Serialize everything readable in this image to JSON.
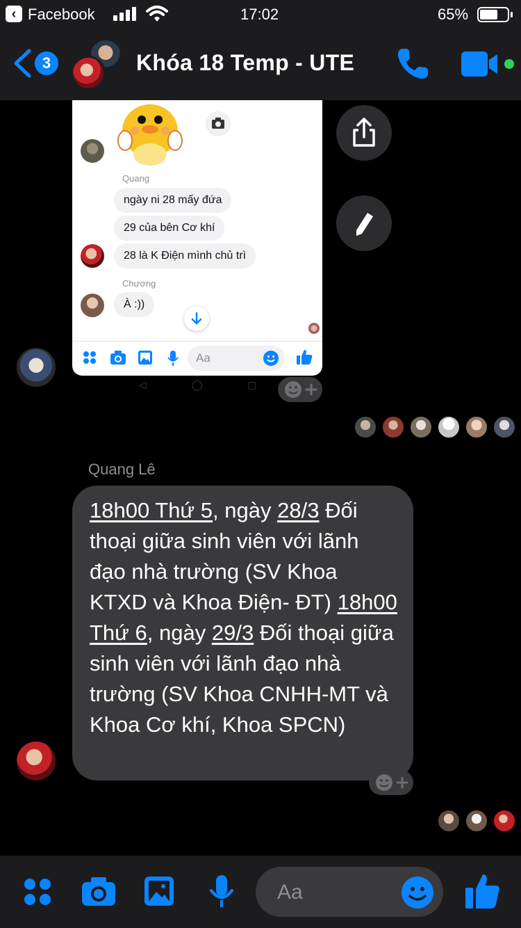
{
  "status_bar": {
    "back_app": "Facebook",
    "time": "17:02",
    "battery_pct": "65%",
    "battery_level": 0.65
  },
  "header": {
    "back_badge": "3",
    "title": "Khóa 18 Temp - UTE",
    "online": true
  },
  "shared_image": {
    "messages": [
      {
        "sender": "Quang",
        "bubbles": [
          "ngày ni 28 mấy đứa",
          "29 của bên Cơ khí",
          "28 là K Điện mình chủ trì"
        ]
      },
      {
        "sender": "Chương",
        "bubbles": [
          "À :))"
        ]
      }
    ],
    "composer_placeholder": "Aa"
  },
  "message": {
    "sender": "Quang Lê",
    "parts": [
      {
        "link": "18h00 Thứ 5"
      },
      {
        "text": ", ngày "
      },
      {
        "link": "28/3"
      },
      {
        "text": "   Đối thoại giữa sinh viên với lãnh đạo nhà trường (SV Khoa KTXD và Khoa Điện- ĐT) "
      },
      {
        "link": "18h00 Thứ 6"
      },
      {
        "text": ", ngày "
      },
      {
        "link": "29/3"
      },
      {
        "text": "   Đối thoại giữa sinh viên với lãnh đạo nhà trường (SV Khoa CNHH-MT và Khoa Cơ khí, Khoa SPCN)"
      }
    ]
  },
  "composer": {
    "placeholder": "Aa"
  },
  "colors": {
    "accent": "#0a84ff",
    "bubble": "#3a3a3c",
    "bar": "#1c1c1e",
    "online": "#31d158"
  },
  "icons": [
    "back-chevron-icon",
    "phone-icon",
    "video-camera-icon",
    "share-icon",
    "pencil-icon",
    "add-reaction-icon",
    "apps-icon",
    "camera-icon",
    "photo-icon",
    "microphone-icon",
    "emoji-icon",
    "thumbs-up-icon"
  ]
}
